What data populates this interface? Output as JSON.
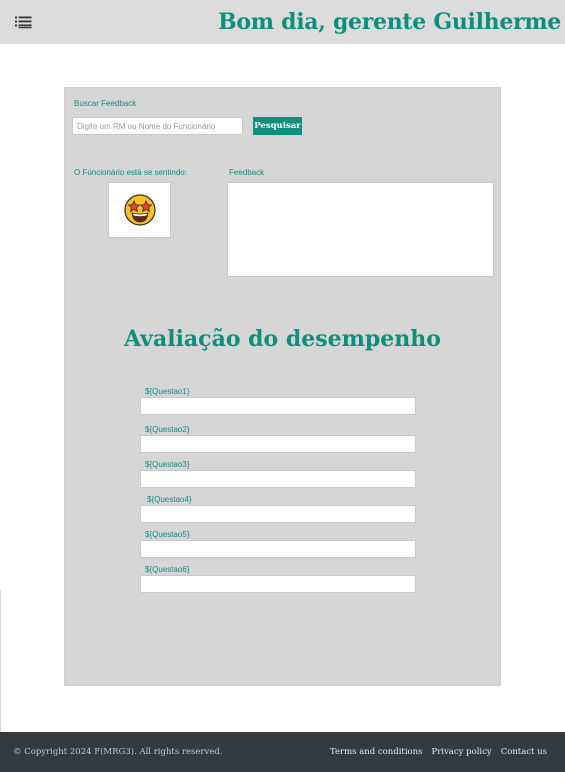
{
  "header": {
    "menu_icon": "list-menu-icon",
    "greeting": "Bom dia, gerente Guilherme"
  },
  "search": {
    "label": "Buscar Feedback",
    "placeholder": "Digite um RM ou Nome do Funcionário",
    "button_label": "Pesquisar"
  },
  "mood": {
    "label": "O Funcionário está se sentindo:",
    "emoji_icon": "star-struck-emoji-icon"
  },
  "feedback": {
    "label": "Feedback"
  },
  "evaluation": {
    "title": "Avaliação do desempenho",
    "questions": [
      {
        "label": "${Questao1}"
      },
      {
        "label": "${Questao2}"
      },
      {
        "label": "${Questao3}"
      },
      {
        "label": "${Questao4}"
      },
      {
        "label": "${Questao5}"
      },
      {
        "label": "${Questao6}"
      }
    ]
  },
  "footer": {
    "copyright": "© Copyright 2024 F(MRG3).  All rights reserved.",
    "links": [
      "Terms and conditions",
      "Privacy policy",
      "Contact us"
    ]
  },
  "colors": {
    "accent": "#0e8f7e",
    "topbar": "#dcdcdc",
    "card": "#d6d6d6",
    "footer": "#343a40"
  }
}
